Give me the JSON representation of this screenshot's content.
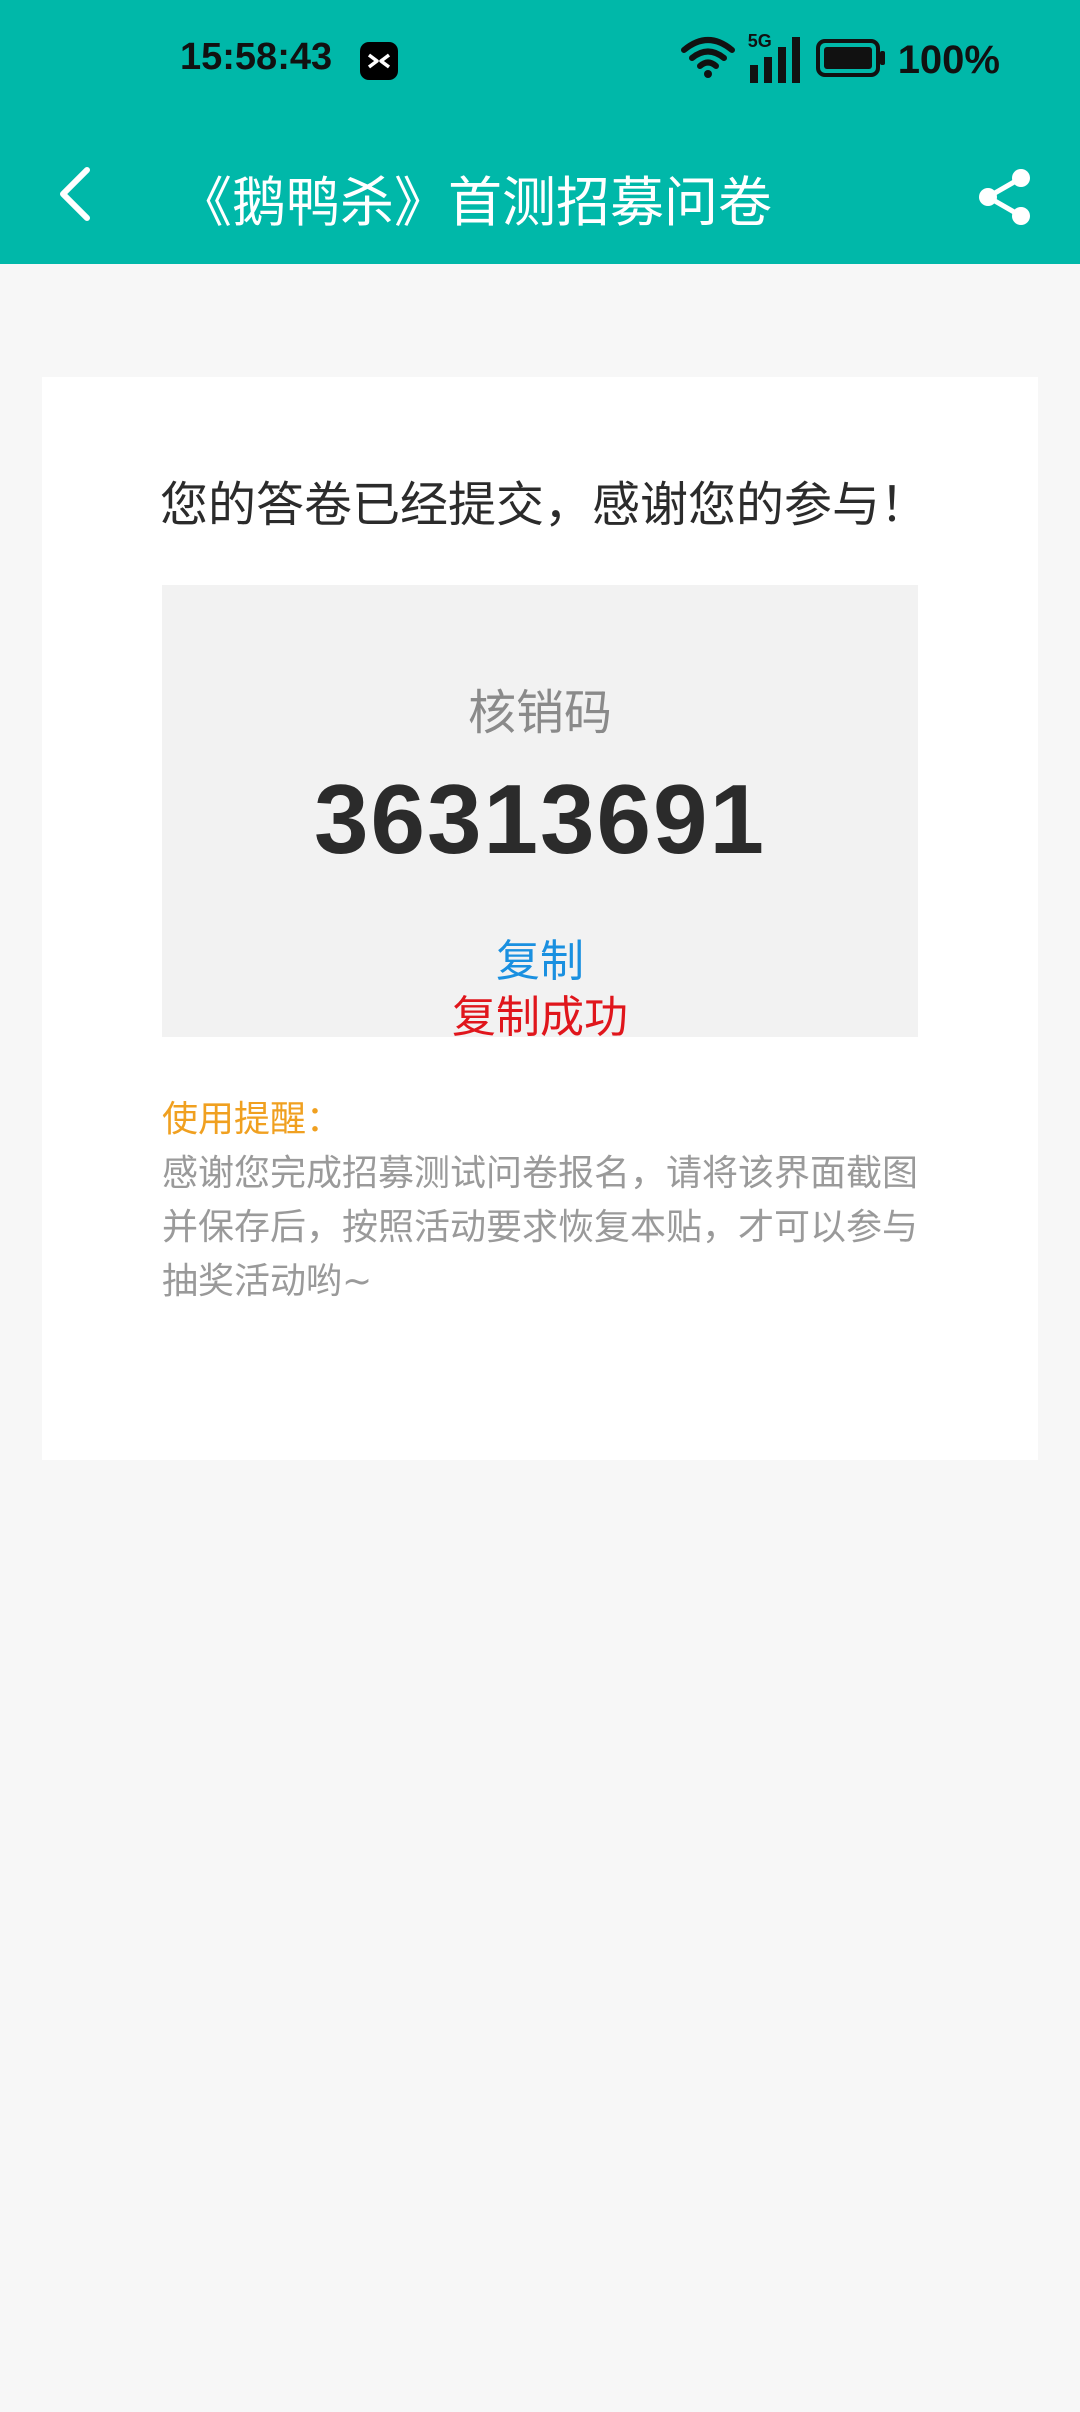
{
  "status_bar": {
    "time": "15:58:43",
    "battery": "100%",
    "network": "5G",
    "icons": [
      "app-icon",
      "wifi-icon",
      "signal-icon",
      "battery-icon"
    ]
  },
  "nav": {
    "title": "《鹅鸭杀》首测招募问卷",
    "back_icon": "chevron-left-icon",
    "share_icon": "share-icon"
  },
  "card": {
    "thanks": "您的答卷已经提交，感谢您的参与！",
    "code_label": "核销码",
    "code_value": "36313691",
    "copy_label": "复制",
    "copy_success": "复制成功",
    "tip_title": "使用提醒：",
    "tip_body": "感谢您完成招募测试问卷报名，请将该界面截图并保存后，按照活动要求恢复本贴，才可以参与抽奖活动哟~"
  },
  "colors": {
    "header": "#00b8a9",
    "background": "#f7f7f7",
    "copy_link": "#1a90e0",
    "success": "#e0161c",
    "tip_title": "#f0a020"
  }
}
